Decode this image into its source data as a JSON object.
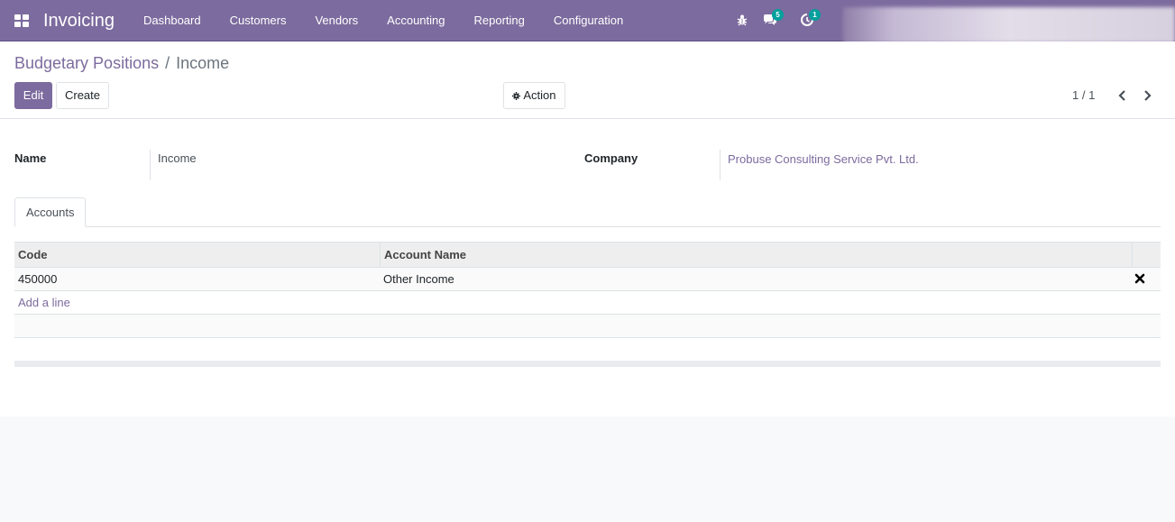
{
  "navbar": {
    "app_title": "Invoicing",
    "menu": [
      "Dashboard",
      "Customers",
      "Vendors",
      "Accounting",
      "Reporting",
      "Configuration"
    ],
    "messages_count": "5",
    "activities_count": "1"
  },
  "breadcrumb": {
    "parent": "Budgetary Positions",
    "separator": "/",
    "current": "Income"
  },
  "toolbar": {
    "edit_label": "Edit",
    "create_label": "Create",
    "action_label": "Action"
  },
  "pager": {
    "value": "1 / 1"
  },
  "form": {
    "name_label": "Name",
    "name_value": "Income",
    "company_label": "Company",
    "company_value": "Probuse Consulting Service Pvt. Ltd."
  },
  "tabs": [
    "Accounts"
  ],
  "accounts_table": {
    "columns": [
      "Code",
      "Account Name"
    ],
    "rows": [
      {
        "code": "450000",
        "account_name": "Other Income"
      }
    ],
    "add_line_label": "Add a line"
  },
  "colors": {
    "brand": "#7c6b9e",
    "badge": "#00a09d"
  }
}
